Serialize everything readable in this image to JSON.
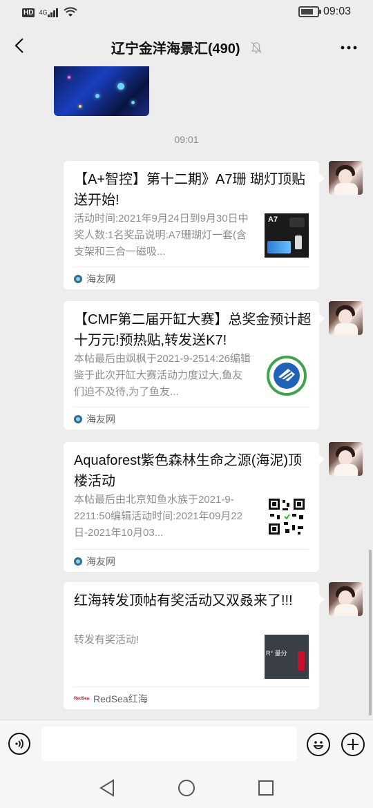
{
  "status_bar": {
    "hd": "HD",
    "network": "4G",
    "time": "09:03"
  },
  "header": {
    "title": "辽宁金洋海景汇(490)"
  },
  "chat": {
    "timestamp": "09:01",
    "messages": [
      {
        "title": "【A+智控】第十二期》A7珊 瑚灯顶贴送开始!",
        "desc": "活动时间:2021年9月24日到9月30日中奖人数:1名奖品说明:A7珊瑚灯一套(含支架和三合一磁吸...",
        "source": "海友网",
        "thumb_label": "A7"
      },
      {
        "title": "【CMF第二届开缸大赛】总奖金预计超十万元!预热贴,转发送K7!",
        "desc": "本帖最后由飒枫于2021-9-2514:26编辑鉴于此次开缸大赛活动力度过大,鱼友们迫不及待,为了鱼友...",
        "source": "海友网"
      },
      {
        "title": "Aquaforest紫色森林生命之源(海泥)顶楼活动",
        "desc": "本帖最后由北京知鱼水族于2021-9-2211:50编辑活动时间:2021年09月22日-2021年10月03...",
        "source": "海友网"
      },
      {
        "title": "红海转发顶帖有奖活动又双叒来了!!!",
        "desc": "转发有奖活动!",
        "source": "RedSea红海",
        "source_icon": "RedSea",
        "thumb_label": "R° 量分"
      }
    ]
  },
  "input": {
    "placeholder": ""
  },
  "colors": {
    "background": "#ededed",
    "card": "#ffffff",
    "desc": "#8e8e8e"
  }
}
